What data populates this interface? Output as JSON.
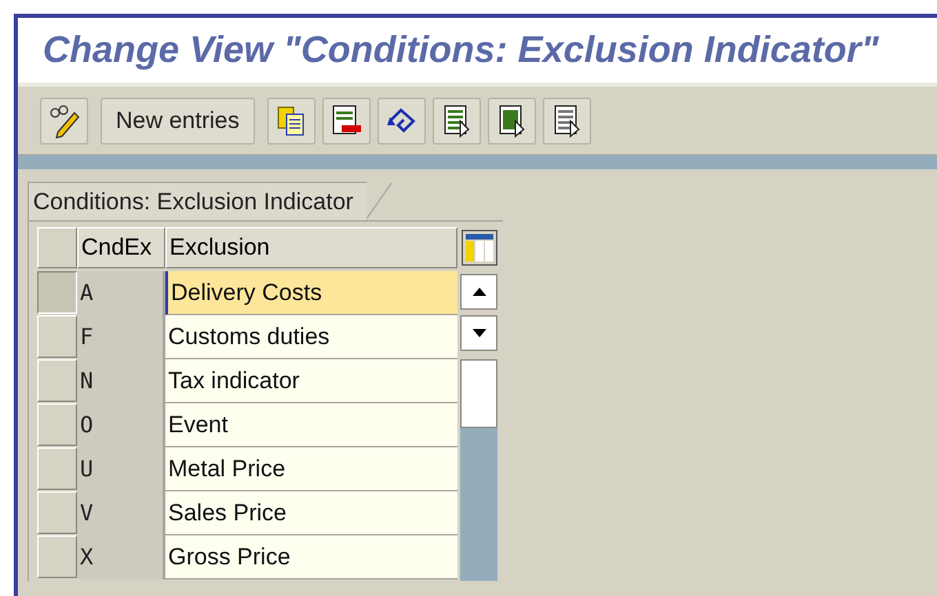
{
  "window": {
    "title": "Change View \"Conditions: Exclusion Indicator\""
  },
  "toolbar": [
    {
      "kind": "icon"
    },
    {
      "kind": "text",
      "label": "New entries"
    },
    {
      "kind": "icon"
    },
    {
      "kind": "icon"
    },
    {
      "kind": "icon"
    },
    {
      "kind": "icon"
    },
    {
      "kind": "icon"
    },
    {
      "kind": "icon"
    }
  ],
  "tab": {
    "label": "Conditions: Exclusion Indicator"
  },
  "table": {
    "columns": [
      "CndEx",
      "Exclusion"
    ],
    "rows": [
      {
        "cells": [
          "A",
          "Delivery Costs"
        ],
        "selected": true
      },
      {
        "cells": [
          "F",
          "Customs duties"
        ],
        "selected": false
      },
      {
        "cells": [
          "N",
          "Tax indicator"
        ],
        "selected": false
      },
      {
        "cells": [
          "O",
          "Event"
        ],
        "selected": false
      },
      {
        "cells": [
          "U",
          "Metal Price"
        ],
        "selected": false
      },
      {
        "cells": [
          "V",
          "Sales Price"
        ],
        "selected": false
      },
      {
        "cells": [
          "X",
          "Gross Price"
        ],
        "selected": false
      }
    ]
  }
}
